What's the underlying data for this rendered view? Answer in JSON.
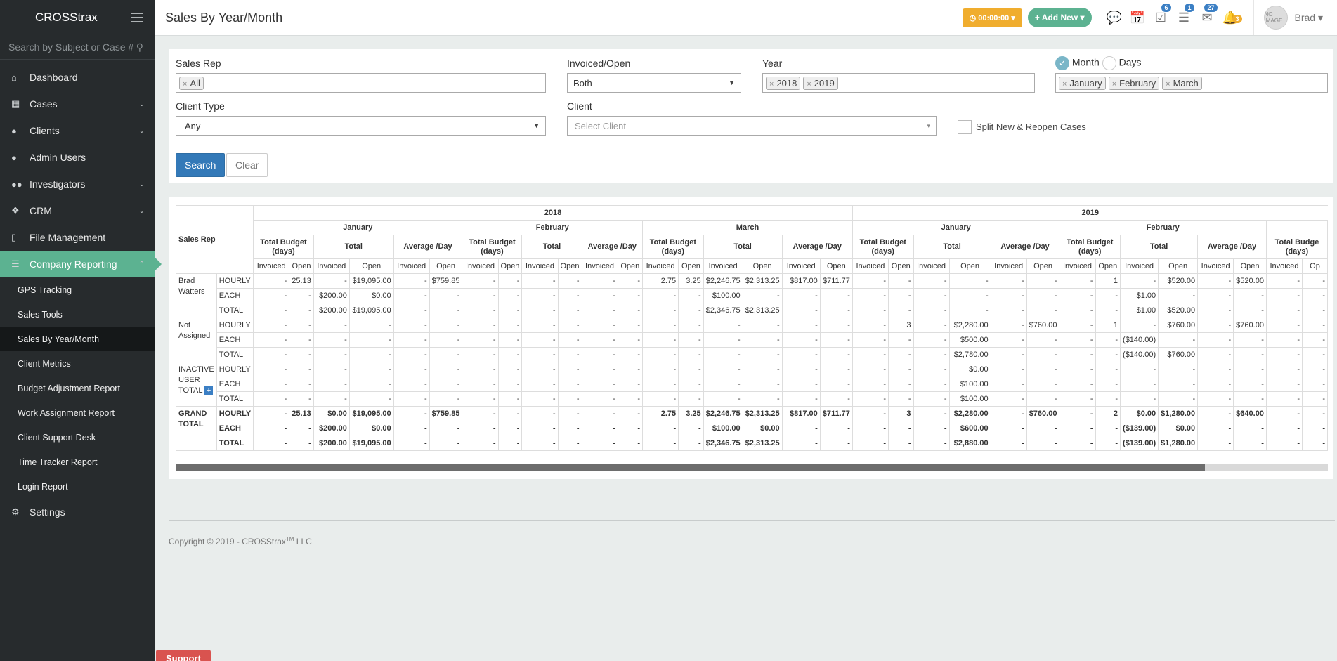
{
  "app": {
    "brand": "CROSStrax"
  },
  "search": {
    "placeholder": "Search by Subject or Case #"
  },
  "sidebar": {
    "items": [
      {
        "label": "Dashboard",
        "icon": "home-icon"
      },
      {
        "label": "Cases",
        "icon": "grid-icon"
      },
      {
        "label": "Clients",
        "icon": "user-icon"
      },
      {
        "label": "Admin Users",
        "icon": "user-icon"
      },
      {
        "label": "Investigators",
        "icon": "users-icon"
      },
      {
        "label": "CRM",
        "icon": "cubes-icon"
      },
      {
        "label": "File Management",
        "icon": "file-icon"
      },
      {
        "label": "Company Reporting",
        "icon": "list-icon"
      },
      {
        "label": "Settings",
        "icon": "gear-icon"
      }
    ],
    "subitems": [
      "GPS Tracking",
      "Sales Tools",
      "Sales By Year/Month",
      "Client Metrics",
      "Budget Adjustment Report",
      "Work Assignment Report",
      "Client Support Desk",
      "Time Tracker Report",
      "Login Report"
    ]
  },
  "header": {
    "title": "Sales By Year/Month",
    "timer": "00:00:00",
    "add_new": "Add New",
    "badges": {
      "tasks": "6",
      "list": "1",
      "mail": "27",
      "bell": "3"
    },
    "avatar_text": "NO IMAGE",
    "username": "Brad"
  },
  "filters": {
    "sales_rep_label": "Sales Rep",
    "sales_rep_chip": "All",
    "invoiced_label": "Invoiced/Open",
    "invoiced_value": "Both",
    "year_label": "Year",
    "years": [
      "2018",
      "2019"
    ],
    "month_label": "Month",
    "days_label": "Days",
    "months": [
      "January",
      "February",
      "March"
    ],
    "client_type_label": "Client Type",
    "client_type_value": "Any",
    "client_label": "Client",
    "client_placeholder": "Select Client",
    "split_label": "Split New & Reopen Cases",
    "search_btn": "Search",
    "clear_btn": "Clear"
  },
  "report": {
    "sales_rep_header": "Sales Rep",
    "years": [
      "2018",
      "2019"
    ],
    "months_2018": [
      "January",
      "February",
      "March"
    ],
    "months_2019": [
      "January",
      "February"
    ],
    "metric_headers": [
      "Total Budget (days)",
      "Total",
      "Average /Day"
    ],
    "sub_headers": [
      "Invoiced",
      "Open"
    ],
    "trailing_header": "Total Budge (days)",
    "trailing_sub": [
      "Invoiced",
      "Op"
    ],
    "groups": [
      {
        "name": "Brad Watters",
        "rows": [
          {
            "type": "HOURLY",
            "cells": [
              "-",
              "25.13",
              "-",
              "$19,095.00",
              "-",
              "$759.85",
              "-",
              "-",
              "-",
              "-",
              "-",
              "-",
              "2.75",
              "3.25",
              "$2,246.75",
              "$2,313.25",
              "$817.00",
              "$711.77",
              "-",
              "-",
              "-",
              "-",
              "-",
              "-",
              "-",
              "1",
              "-",
              "$520.00",
              "-",
              "$520.00",
              "-",
              "-"
            ]
          },
          {
            "type": "EACH",
            "cells": [
              "-",
              "-",
              "$200.00",
              "$0.00",
              "-",
              "-",
              "-",
              "-",
              "-",
              "-",
              "-",
              "-",
              "-",
              "-",
              "$100.00",
              "-",
              "-",
              "-",
              "-",
              "-",
              "-",
              "-",
              "-",
              "-",
              "-",
              "-",
              "$1.00",
              "-",
              "-",
              "-",
              "-",
              "-"
            ]
          },
          {
            "type": "TOTAL",
            "cells": [
              "-",
              "-",
              "$200.00",
              "$19,095.00",
              "-",
              "-",
              "-",
              "-",
              "-",
              "-",
              "-",
              "-",
              "-",
              "-",
              "$2,346.75",
              "$2,313.25",
              "-",
              "-",
              "-",
              "-",
              "-",
              "-",
              "-",
              "-",
              "-",
              "-",
              "$1.00",
              "$520.00",
              "-",
              "-",
              "-",
              "-"
            ]
          }
        ]
      },
      {
        "name": "Not Assigned",
        "rows": [
          {
            "type": "HOURLY",
            "cells": [
              "-",
              "-",
              "-",
              "-",
              "-",
              "-",
              "-",
              "-",
              "-",
              "-",
              "-",
              "-",
              "-",
              "-",
              "-",
              "-",
              "-",
              "-",
              "-",
              "3",
              "-",
              "$2,280.00",
              "-",
              "$760.00",
              "-",
              "1",
              "-",
              "$760.00",
              "-",
              "$760.00",
              "-",
              "-"
            ]
          },
          {
            "type": "EACH",
            "cells": [
              "-",
              "-",
              "-",
              "-",
              "-",
              "-",
              "-",
              "-",
              "-",
              "-",
              "-",
              "-",
              "-",
              "-",
              "-",
              "-",
              "-",
              "-",
              "-",
              "-",
              "-",
              "$500.00",
              "-",
              "-",
              "-",
              "-",
              "($140.00)",
              "-",
              "-",
              "-",
              "-",
              "-"
            ]
          },
          {
            "type": "TOTAL",
            "cells": [
              "-",
              "-",
              "-",
              "-",
              "-",
              "-",
              "-",
              "-",
              "-",
              "-",
              "-",
              "-",
              "-",
              "-",
              "-",
              "-",
              "-",
              "-",
              "-",
              "-",
              "-",
              "$2,780.00",
              "-",
              "-",
              "-",
              "-",
              "($140.00)",
              "$760.00",
              "-",
              "-",
              "-",
              "-"
            ]
          }
        ]
      },
      {
        "name": "INACTIVE USER TOTAL",
        "rows": [
          {
            "type": "HOURLY",
            "cells": [
              "-",
              "-",
              "-",
              "-",
              "-",
              "-",
              "-",
              "-",
              "-",
              "-",
              "-",
              "-",
              "-",
              "-",
              "-",
              "-",
              "-",
              "-",
              "-",
              "-",
              "-",
              "$0.00",
              "-",
              "-",
              "-",
              "-",
              "-",
              "-",
              "-",
              "-",
              "-",
              "-"
            ]
          },
          {
            "type": "EACH",
            "cells": [
              "-",
              "-",
              "-",
              "-",
              "-",
              "-",
              "-",
              "-",
              "-",
              "-",
              "-",
              "-",
              "-",
              "-",
              "-",
              "-",
              "-",
              "-",
              "-",
              "-",
              "-",
              "$100.00",
              "-",
              "-",
              "-",
              "-",
              "-",
              "-",
              "-",
              "-",
              "-",
              "-"
            ]
          },
          {
            "type": "TOTAL",
            "cells": [
              "-",
              "-",
              "-",
              "-",
              "-",
              "-",
              "-",
              "-",
              "-",
              "-",
              "-",
              "-",
              "-",
              "-",
              "-",
              "-",
              "-",
              "-",
              "-",
              "-",
              "-",
              "$100.00",
              "-",
              "-",
              "-",
              "-",
              "-",
              "-",
              "-",
              "-",
              "-",
              "-"
            ]
          }
        ]
      },
      {
        "name": "GRAND TOTAL",
        "rows": [
          {
            "type": "HOURLY",
            "cells": [
              "-",
              "25.13",
              "$0.00",
              "$19,095.00",
              "-",
              "$759.85",
              "-",
              "-",
              "-",
              "-",
              "-",
              "-",
              "2.75",
              "3.25",
              "$2,246.75",
              "$2,313.25",
              "$817.00",
              "$711.77",
              "-",
              "3",
              "-",
              "$2,280.00",
              "-",
              "$760.00",
              "-",
              "2",
              "$0.00",
              "$1,280.00",
              "-",
              "$640.00",
              "-",
              "-"
            ]
          },
          {
            "type": "EACH",
            "cells": [
              "-",
              "-",
              "$200.00",
              "$0.00",
              "-",
              "-",
              "-",
              "-",
              "-",
              "-",
              "-",
              "-",
              "-",
              "-",
              "$100.00",
              "$0.00",
              "-",
              "-",
              "-",
              "-",
              "-",
              "$600.00",
              "-",
              "-",
              "-",
              "-",
              "($139.00)",
              "$0.00",
              "-",
              "-",
              "-",
              "-"
            ]
          },
          {
            "type": "TOTAL",
            "cells": [
              "-",
              "-",
              "$200.00",
              "$19,095.00",
              "-",
              "-",
              "-",
              "-",
              "-",
              "-",
              "-",
              "-",
              "-",
              "-",
              "$2,346.75",
              "$2,313.25",
              "-",
              "-",
              "-",
              "-",
              "-",
              "$2,880.00",
              "-",
              "-",
              "-",
              "-",
              "($139.00)",
              "$1,280.00",
              "-",
              "-",
              "-",
              "-"
            ]
          }
        ]
      }
    ]
  },
  "footer": {
    "copyright": "Copyright © 2019 - CROSStrax",
    "tm": "TM",
    "llc": " LLC"
  },
  "support": {
    "label": "Support"
  }
}
